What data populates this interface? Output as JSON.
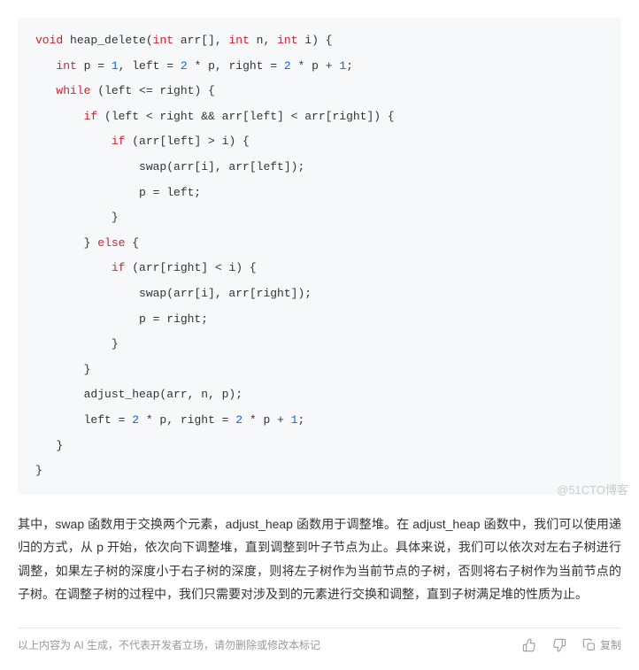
{
  "code": {
    "lines": [
      "void heap_delete(int arr[], int n, int i) {",
      "   int p = 1, left = 2 * p, right = 2 * p + 1;",
      "   while (left <= right) {",
      "       if (left < right && arr[left] < arr[right]) {",
      "           if (arr[left] > i) {",
      "               swap(arr[i], arr[left]);",
      "               p = left;",
      "           }",
      "       } else {",
      "           if (arr[right] < i) {",
      "               swap(arr[i], arr[right]);",
      "               p = right;",
      "           }",
      "       }",
      "       adjust_heap(arr, n, p);",
      "       left = 2 * p, right = 2 * p + 1;",
      "   }",
      "}"
    ]
  },
  "paragraph": "其中，swap 函数用于交换两个元素，adjust_heap 函数用于调整堆。在 adjust_heap 函数中，我们可以使用递归的方式，从 p 开始，依次向下调整堆，直到调整到叶子节点为止。具体来说，我们可以依次对左右子树进行调整，如果左子树的深度小于右子树的深度，则将左子树作为当前节点的子树，否则将右子树作为当前节点的子树。在调整子树的过程中，我们只需要对涉及到的元素进行交换和调整，直到子树满足堆的性质为止。",
  "footer": {
    "disclaimer": "以上内容为 AI 生成，不代表开发者立场，请勿删除或修改本标记",
    "copy_label": "复制"
  },
  "watermark": "@51CTO博客"
}
